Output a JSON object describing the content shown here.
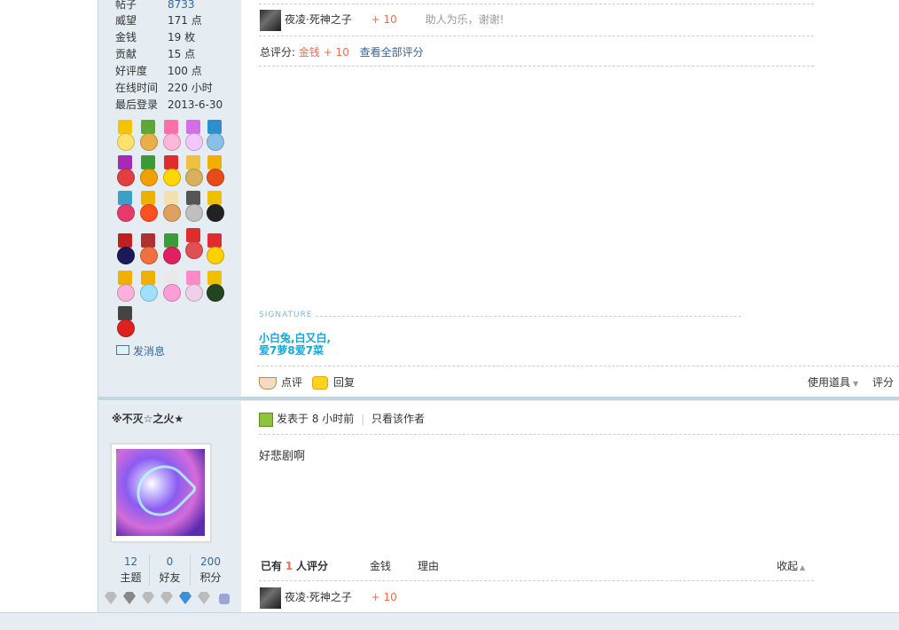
{
  "profile1": {
    "stats": [
      {
        "label": "帖子",
        "value": "8733"
      },
      {
        "label": "威望",
        "value": "171 点"
      },
      {
        "label": "金钱",
        "value": "19 枚"
      },
      {
        "label": "贡献",
        "value": "15 点"
      },
      {
        "label": "好评度",
        "value": "100 点"
      },
      {
        "label": "在线时间",
        "value": "220 小时"
      },
      {
        "label": "最后登录",
        "value": "2013-6-30"
      }
    ],
    "send_message": "发消息"
  },
  "post1": {
    "rating_item": {
      "user": "夜凌·死神之子",
      "score": "+ 10",
      "reason": "助人为乐，谢谢!"
    },
    "total_label": "总评分:",
    "total_value": "金钱 + 10",
    "view_all": "查看全部评分",
    "signature_label": "SIGNATURE",
    "signature_lines": [
      "小白兔,白又白,",
      "爱7萝8爱7菜"
    ],
    "actions": {
      "comment": "点评",
      "reply": "回复",
      "use_tool": "使用道具",
      "rate": "评分"
    }
  },
  "profile2": {
    "name": "※不灭☆之火★",
    "stats": [
      {
        "value": "12",
        "label": "主题"
      },
      {
        "value": "0",
        "label": "好友"
      },
      {
        "value": "200",
        "label": "积分"
      }
    ]
  },
  "post2": {
    "posted_prefix": "发表于",
    "posted_time": "8 小时前",
    "only_author": "只看该作者",
    "body": "好悲剧啊",
    "rating_header": {
      "prefix": "已有",
      "count": "1",
      "suffix": "人评分",
      "col_money": "金钱",
      "col_reason": "理由",
      "collapse": "收起"
    },
    "rating_item": {
      "user": "夜凌·死神之子",
      "score": "+ 10"
    }
  }
}
